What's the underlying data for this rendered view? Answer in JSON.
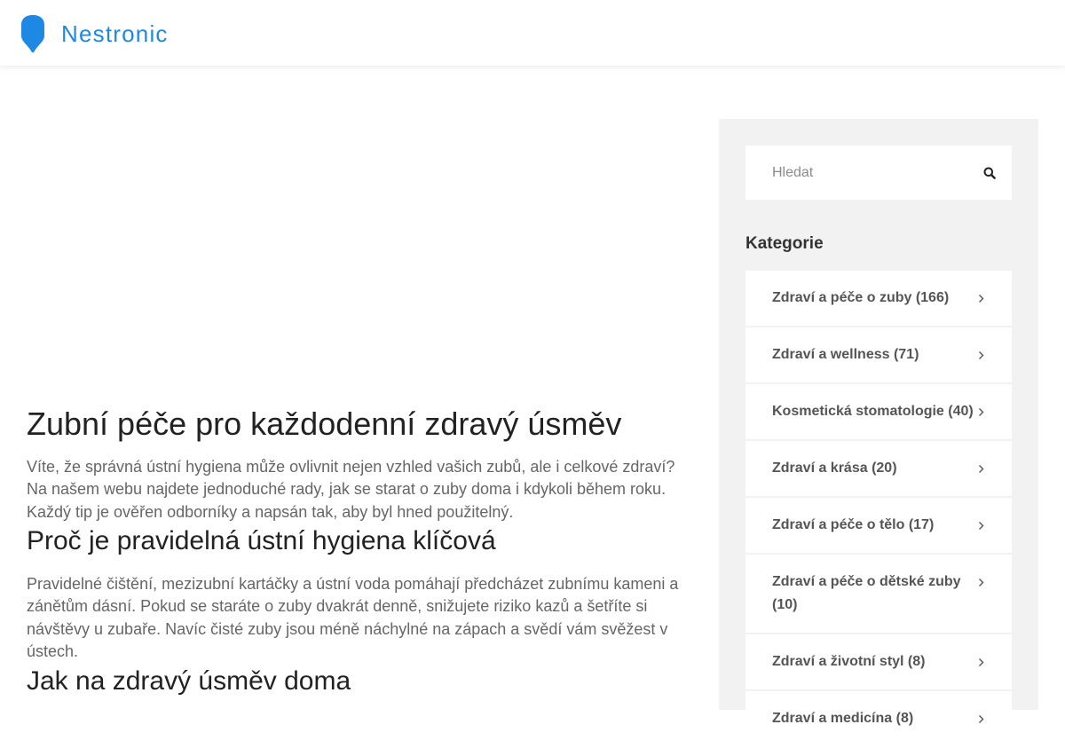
{
  "site": {
    "brand": "Nestronic",
    "brand_color": "#1e88e5"
  },
  "article": {
    "title": "Zubní péče pro každodenní zdravý úsměv",
    "intro": "Víte, že správná ústní hygiena může ovlivnit nejen vzhled vašich zubů, ale i celkové zdraví? Na našem webu najdete jednoduché rady, jak se starat o zuby doma i kdykoli během roku. Každý tip je ověřen odborníky a napsán tak, aby byl hned použitelný.",
    "section1_heading": "Proč je pravidelná ústní hygiena klíčová",
    "section1_text": "Pravidelné čištění, mezizubní kartáčky a ústní voda pomáhají předcházet zubnímu kameni a zánětům dásní. Pokud se staráte o zuby dvakrát denně, snižujete riziko kazů a šetříte si návštěvy u zubaře. Navíc čisté zuby jsou méně náchylné na zápach a svědí vám svěžest v ústech.",
    "section2_heading": "Jak na zdravý úsměv doma"
  },
  "sidebar": {
    "search": {
      "placeholder": "Hledat",
      "value": "",
      "icon": "search-icon"
    },
    "categories_title": "Kategorie",
    "categories": [
      {
        "label": "Zdraví a péče o zuby (166)",
        "icon": "chevron-right-icon"
      },
      {
        "label": "Zdraví a wellness (71)",
        "icon": "chevron-right-icon"
      },
      {
        "label": "Kosmetická stomatologie (40)",
        "icon": "chevron-right-icon"
      },
      {
        "label": "Zdraví a krása (20)",
        "icon": "chevron-right-icon"
      },
      {
        "label": "Zdraví a péče o tělo (17)",
        "icon": "chevron-right-icon"
      },
      {
        "label": "Zdraví a péče o dětské zuby (10)",
        "icon": "chevron-right-icon"
      },
      {
        "label": "Zdraví a životní styl (8)",
        "icon": "chevron-right-icon"
      },
      {
        "label": "Zdraví a medicína (8)",
        "icon": "chevron-right-icon"
      }
    ]
  }
}
